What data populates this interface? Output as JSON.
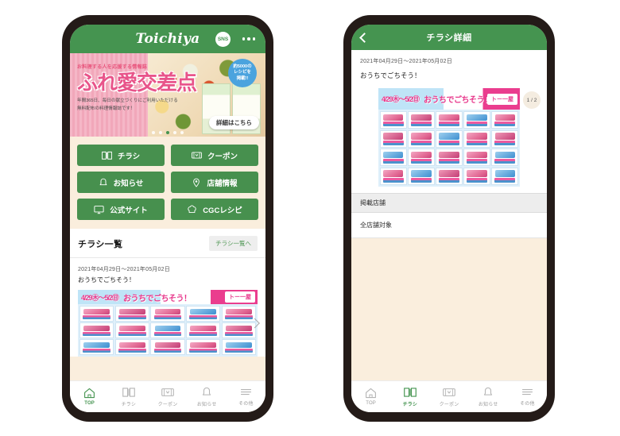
{
  "colors": {
    "brand_green": "#459450",
    "button_green": "#47904e",
    "page_cream": "#faeedd",
    "bezel": "#241b18",
    "pink": "#e8548a",
    "badge_blue": "#4ba3de"
  },
  "phone1": {
    "header": {
      "logo": "Toichiya",
      "sns_badge": "SNS",
      "menu_icon": "kebab-menu-icon"
    },
    "hero": {
      "subtitle": "お料理する人を応援する情報誌",
      "title": "ふれ愛交差点",
      "description_line1": "年間365日、毎日の献立づくりにご利用いただける",
      "description_line2": "無料配布の料理情報誌です！",
      "badge_line1": "約5000の",
      "badge_line2": "レシピを",
      "badge_line3": "掲載!!",
      "cta": "詳細はこちら",
      "dots": 5,
      "active_dot": 3
    },
    "menu": [
      {
        "label": "チラシ",
        "icon": "book-icon"
      },
      {
        "label": "クーポン",
        "icon": "ticket-icon"
      },
      {
        "label": "お知らせ",
        "icon": "bell-icon"
      },
      {
        "label": "店舗情報",
        "icon": "map-pin-icon"
      },
      {
        "label": "公式サイト",
        "icon": "monitor-icon"
      },
      {
        "label": "CGCレシピ",
        "icon": "chef-hat-icon"
      }
    ],
    "flyer_list": {
      "title": "チラシ一覧",
      "more_label": "チラシ一覧へ",
      "items": [
        {
          "date": "2021年04月29日～2021年05月02日",
          "name": "おうちでごちそう！",
          "flyer_date_text": "4/29㊍～5/2㊐",
          "flyer_slogan": "おうちでごちそう！",
          "flyer_logo": "トー一屋"
        }
      ]
    },
    "tabs": [
      {
        "label": "TOP",
        "icon": "home-icon",
        "active": true
      },
      {
        "label": "チラシ",
        "icon": "book-icon",
        "active": false
      },
      {
        "label": "クーポン",
        "icon": "ticket-icon",
        "active": false
      },
      {
        "label": "お知らせ",
        "icon": "bell-icon",
        "active": false
      },
      {
        "label": "その他",
        "icon": "menu-lines-icon",
        "active": false
      }
    ]
  },
  "phone2": {
    "header": {
      "title": "チラシ詳細",
      "back_icon": "chevron-left-icon"
    },
    "detail": {
      "date": "2021年04月29日～2021年05月02日",
      "name": "おうちでごちそう！",
      "page_badge": "1 / 2",
      "flyer_date_text": "4/29㊍～5/2㊐",
      "flyer_slogan": "おうちでごちそう！",
      "flyer_logo": "トー一屋",
      "section_title": "掲載店舗",
      "section_value": "全店舗対象"
    },
    "tabs": [
      {
        "label": "TOP",
        "icon": "home-icon",
        "active": false
      },
      {
        "label": "チラシ",
        "icon": "book-icon",
        "active": true
      },
      {
        "label": "クーポン",
        "icon": "ticket-icon",
        "active": false
      },
      {
        "label": "お知らせ",
        "icon": "bell-icon",
        "active": false
      },
      {
        "label": "その他",
        "icon": "menu-lines-icon",
        "active": false
      }
    ]
  }
}
